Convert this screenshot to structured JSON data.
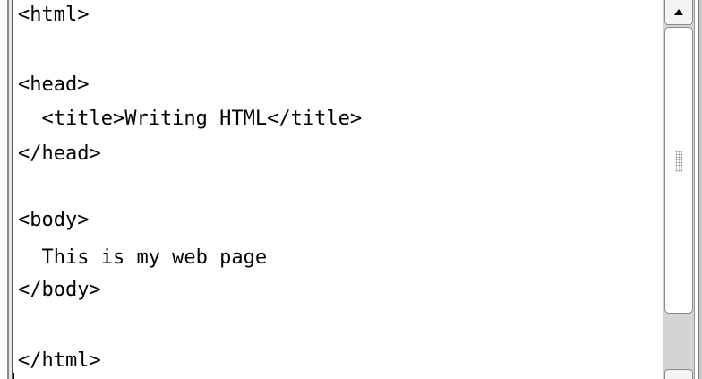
{
  "editor": {
    "lines": [
      "<html>",
      "",
      "<head>",
      "  <title>Writing HTML</title>",
      "</head>",
      "",
      "<body>",
      "  This is my web page",
      "</body>",
      "",
      "</html>"
    ]
  },
  "scrollbar": {
    "up_icon": "arrow-up-icon",
    "grip_icon": "grip-dots-icon"
  }
}
